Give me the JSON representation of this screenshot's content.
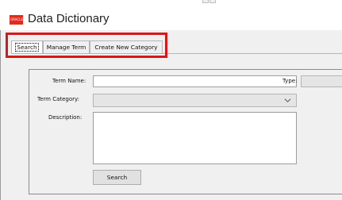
{
  "window": {
    "title": "Data Dictionary",
    "logo_text": "ORACLE"
  },
  "tabs": [
    {
      "label": "Search",
      "active": true
    },
    {
      "label": "Manage Term",
      "active": false
    },
    {
      "label": "Create New Category",
      "active": false
    }
  ],
  "form": {
    "term_name_label": "Term Name:",
    "term_name_value": "",
    "type_label": "Type:",
    "term_category_label": "Term Category:",
    "term_category_value": "",
    "description_label": "Description:",
    "description_value": "",
    "search_button": "Search"
  },
  "colors": {
    "highlight": "#d81818",
    "logo": "#e32b1c"
  }
}
